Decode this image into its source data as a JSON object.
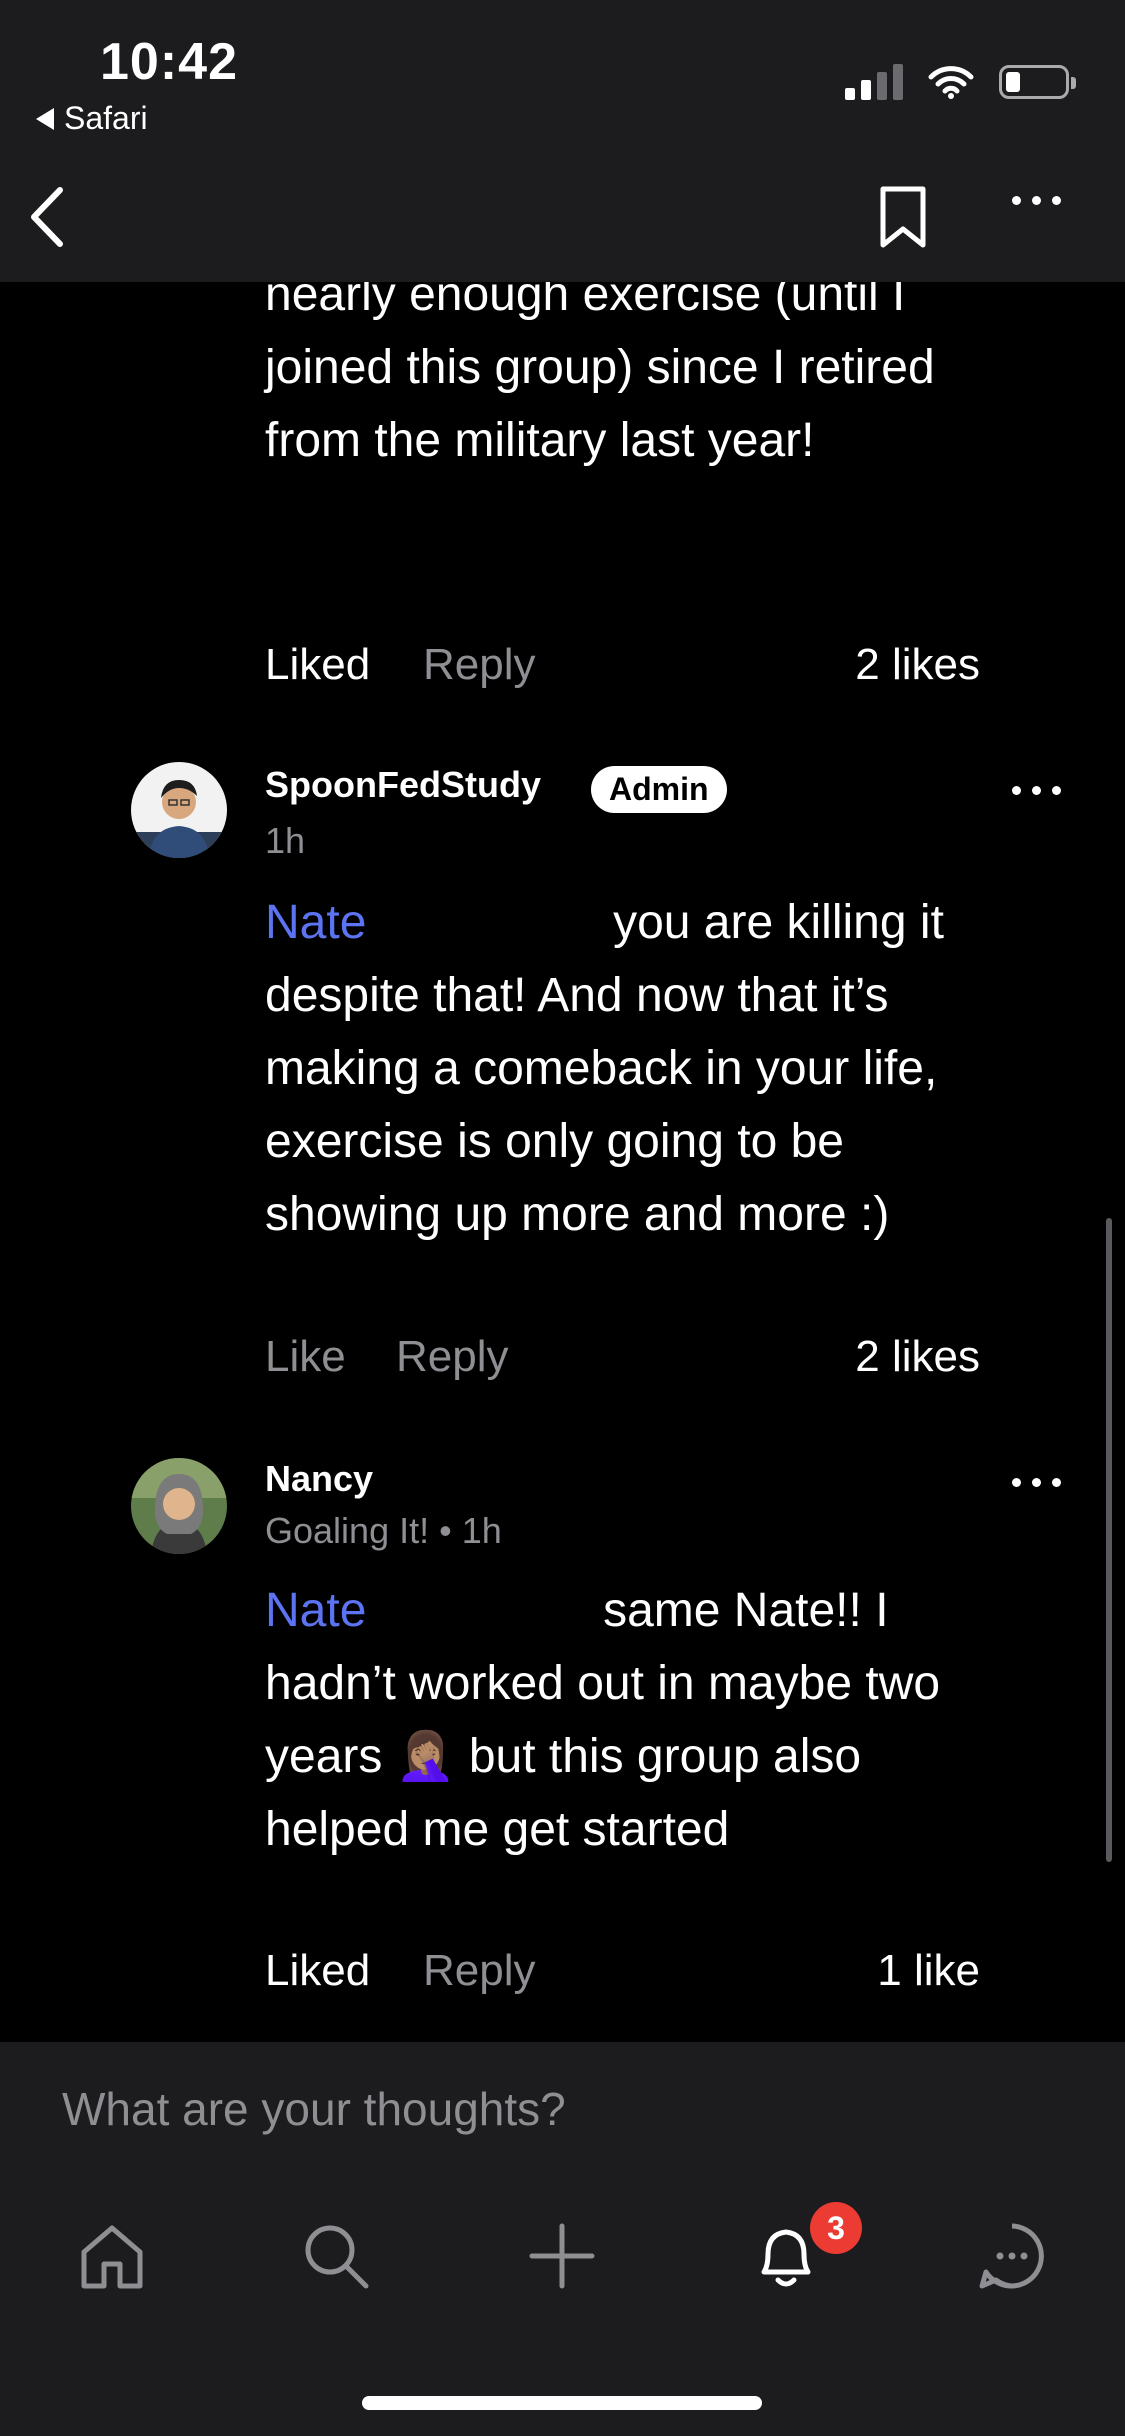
{
  "status": {
    "time": "10:42",
    "back_app": "Safari"
  },
  "comments": [
    {
      "partial_text": "nearly enough exercise (until I joined this group) since I retired from the military last year!",
      "like_label": "Liked",
      "reply_label": "Reply",
      "likes": "2 likes"
    },
    {
      "author": "SpoonFedStudy",
      "badge": "Admin",
      "meta": "1h",
      "mention": "Nate",
      "text": "you are killing it despite that! And now that it’s making a comeback in your life, exercise is only going to be showing up more and more :)",
      "like_label": "Like",
      "reply_label": "Reply",
      "likes": "2 likes"
    },
    {
      "author": "Nancy",
      "meta": "Goaling It! • 1h",
      "mention": "Nate",
      "text_part1": "same Nate!! I hadn’t worked out in maybe two years",
      "emoji": "🤦🏽‍♀️",
      "text_part2": "but this group also helped me get started",
      "like_label": "Liked",
      "reply_label": "Reply",
      "likes": "1 like"
    }
  ],
  "composer": {
    "placeholder": "What are your thoughts?"
  },
  "tabs": [
    {
      "icon": "home-icon"
    },
    {
      "icon": "search-icon"
    },
    {
      "icon": "plus-icon"
    },
    {
      "icon": "bell-icon",
      "badge": "3"
    },
    {
      "icon": "chat-icon"
    }
  ],
  "colors": {
    "mention": "#5c73f2",
    "badge": "#eb3b32",
    "bar": "#1c1c1e"
  }
}
